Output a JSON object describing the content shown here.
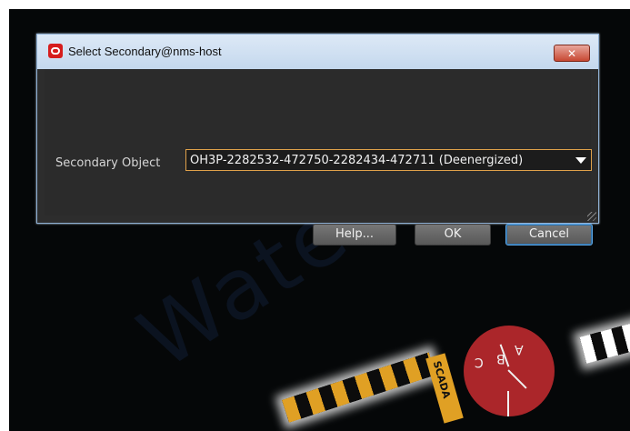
{
  "dialog": {
    "title": "Select Secondary@nms-host",
    "close_glyph": "✕",
    "field_label": "Secondary Object",
    "selected_value": "OH3P-2282532-472750-2282434-472711 (Deenergized)",
    "buttons": {
      "help": "Help...",
      "ok": "OK",
      "cancel": "Cancel"
    }
  },
  "background": {
    "watermark": "Watermark",
    "scada_label": "SCADA",
    "phase_labels": {
      "a": "A",
      "b": "B",
      "c": "C"
    }
  },
  "colors": {
    "title_bar": "#c4d8ee",
    "accent": "#e0a14a",
    "close_button": "#c74832",
    "phase_circle": "#ab262a"
  },
  "icons": [
    "oracle-app-icon",
    "close-icon",
    "dropdown-arrow-icon",
    "resize-grip-icon"
  ]
}
